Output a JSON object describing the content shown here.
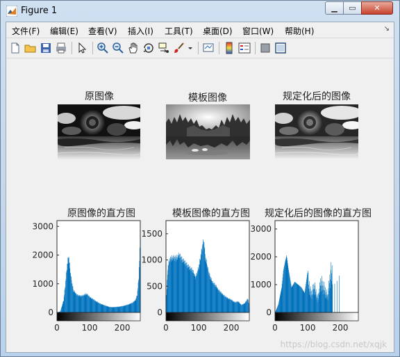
{
  "window": {
    "title": "Figure 1",
    "minimize_icon": "minimize-icon",
    "maximize_icon": "maximize-icon",
    "close_icon": "close-icon"
  },
  "menu": {
    "items": [
      "文件(F)",
      "编辑(E)",
      "查看(V)",
      "插入(I)",
      "工具(T)",
      "桌面(D)",
      "窗口(W)",
      "帮助(H)"
    ],
    "overflow_glyph": "↘"
  },
  "toolbar": {
    "icons": [
      "new-figure-icon",
      "open-icon",
      "save-icon",
      "print-icon",
      "pointer-icon",
      "zoom-in-icon",
      "zoom-out-icon",
      "pan-icon",
      "rotate-3d-icon",
      "data-cursor-icon",
      "brush-icon",
      "brush-dropdown-icon",
      "link-plot-icon",
      "colorbar-icon",
      "legend-icon",
      "hide-plot-tools-icon",
      "show-plot-tools-icon"
    ]
  },
  "panels": {
    "original_title": "原图像",
    "template_title": "模板图像",
    "matched_title": "规定化后的图像"
  },
  "histograms": {
    "original_title": "原图像的直方图",
    "template_title": "模板图像的直方图",
    "matched_title": "规定化后的图像的直方图",
    "xticks": [
      "0",
      "100",
      "200"
    ],
    "original_yticks": [
      "0",
      "1000",
      "2000",
      "3000"
    ],
    "template_yticks": [
      "0",
      "500",
      "1000",
      "1500"
    ],
    "matched_yticks": [
      "0",
      "1000",
      "2000",
      "3000"
    ]
  },
  "chart_data": [
    {
      "type": "bar",
      "title": "原图像的直方图",
      "xlim": [
        0,
        255
      ],
      "ylim": [
        0,
        3200
      ],
      "x": [
        0,
        10,
        20,
        25,
        30,
        35,
        40,
        45,
        50,
        60,
        70,
        80,
        90,
        100,
        110,
        120,
        130,
        140,
        150,
        160,
        170,
        180,
        190,
        200,
        210,
        220,
        230,
        240,
        245,
        250,
        255
      ],
      "values": [
        0,
        40,
        450,
        1000,
        1650,
        2100,
        1500,
        1100,
        800,
        650,
        600,
        620,
        680,
        560,
        480,
        400,
        330,
        280,
        240,
        200,
        190,
        200,
        210,
        230,
        260,
        300,
        350,
        450,
        650,
        1300,
        2900
      ]
    },
    {
      "type": "bar",
      "title": "模板图像的直方图",
      "xlim": [
        0,
        255
      ],
      "ylim": [
        0,
        1750
      ],
      "x": [
        0,
        5,
        10,
        20,
        30,
        40,
        50,
        60,
        70,
        80,
        90,
        100,
        110,
        115,
        120,
        130,
        140,
        150,
        160,
        170,
        180,
        190,
        200,
        210,
        220,
        230,
        240,
        250,
        255
      ],
      "values": [
        200,
        900,
        1050,
        1100,
        1080,
        1150,
        1050,
        980,
        900,
        850,
        700,
        900,
        1300,
        1450,
        1100,
        800,
        620,
        550,
        450,
        380,
        320,
        280,
        250,
        200,
        220,
        150,
        180,
        280,
        100
      ]
    },
    {
      "type": "bar",
      "title": "规定化后的图像的直方图",
      "xlim": [
        0,
        255
      ],
      "ylim": [
        0,
        3300
      ],
      "x": [
        0,
        10,
        20,
        25,
        30,
        35,
        40,
        45,
        50,
        60,
        70,
        80,
        90,
        100,
        110,
        120,
        130,
        140,
        150,
        160,
        170,
        185,
        195,
        200
      ],
      "values": [
        0,
        300,
        900,
        1500,
        1800,
        2050,
        1600,
        1250,
        900,
        1100,
        1000,
        900,
        700,
        1500,
        800,
        1200,
        600,
        1400,
        1100,
        700,
        1800,
        1900,
        2300,
        2800
      ]
    }
  ],
  "colors": {
    "bar": "#0072bd",
    "axes_bg": "#ffffff",
    "figure_bg": "#f0f0f0"
  },
  "watermark": "https://blog.csdn.net/xqjk"
}
